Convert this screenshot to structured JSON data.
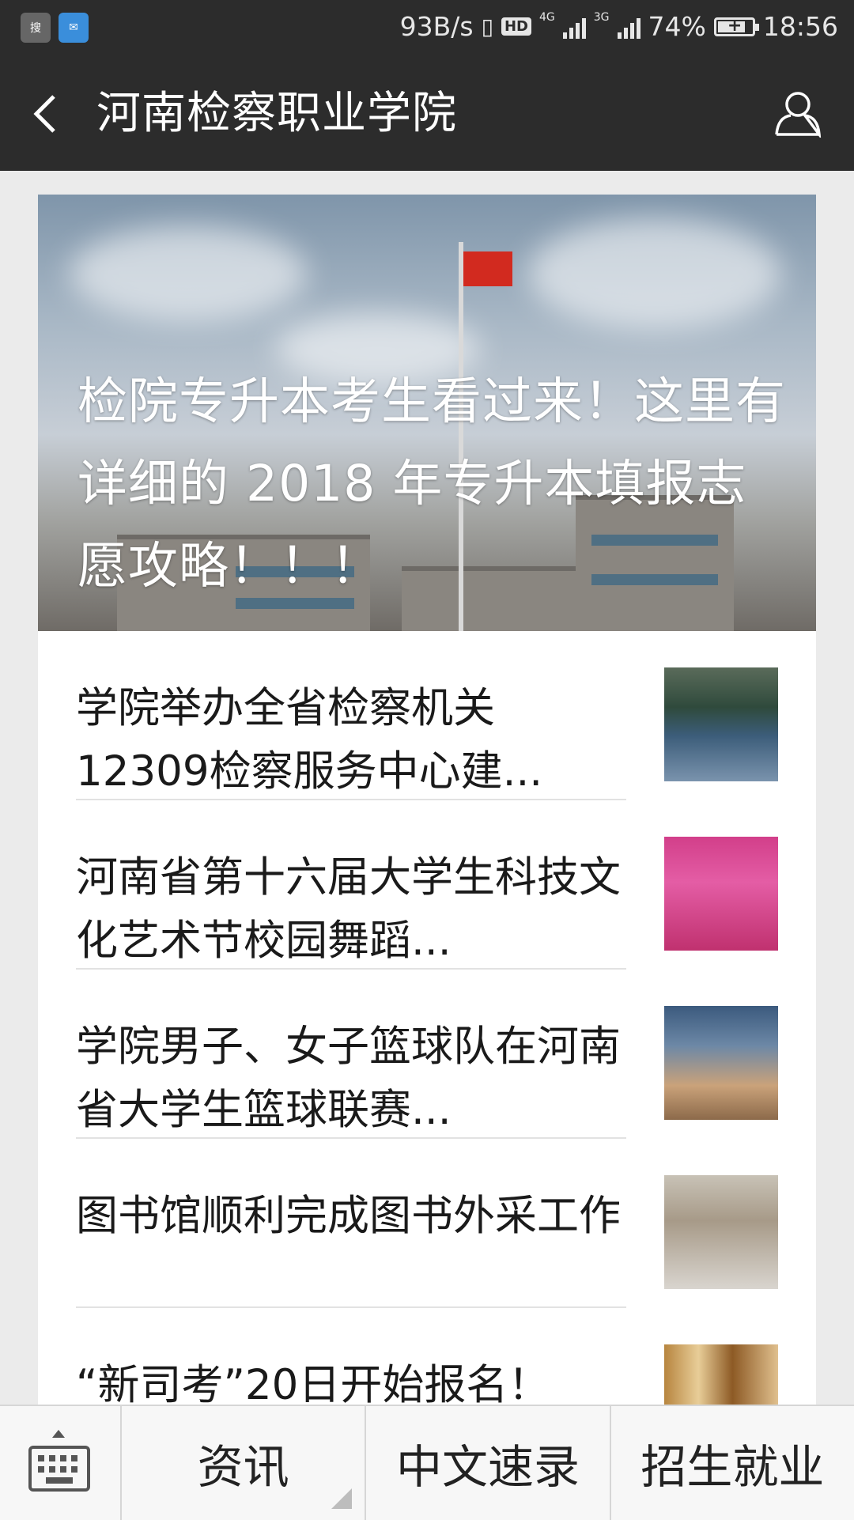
{
  "status_bar": {
    "speed": "93B/s",
    "hd": "HD",
    "net1": "4G",
    "net2": "3G",
    "battery": "74%",
    "time": "18:56",
    "icons": [
      "sogou-input-icon",
      "mail-icon",
      "vibrate-icon",
      "signal-icon",
      "battery-icon"
    ]
  },
  "header": {
    "title": "河南检察职业学院"
  },
  "hero": {
    "title": "检院专升本考生看过来！这里有详细的 2018 年专升本填报志愿攻略！！！"
  },
  "articles": [
    {
      "title": "学院举办全省检察机关12309检察服务中心建..."
    },
    {
      "title": "河南省第十六届大学生科技文化艺术节校园舞蹈..."
    },
    {
      "title": "学院男子、女子篮球队在河南省大学生篮球联赛..."
    },
    {
      "title": "图书馆顺利完成图书外采工作"
    },
    {
      "title": "“新司考”20日开始报名！"
    }
  ],
  "menu": {
    "items": [
      "资讯",
      "中文速录",
      "招生就业"
    ]
  }
}
